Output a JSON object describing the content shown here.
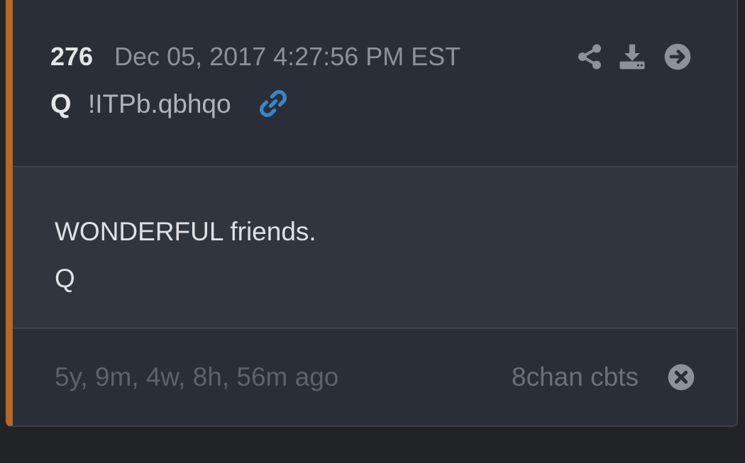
{
  "post": {
    "number": "276",
    "date": "Dec 05, 2017 4:27:56 PM EST",
    "author": "Q",
    "tripcode": "!ITPb.qbhqo",
    "body_lines": [
      "WONDERFUL friends.",
      "Q"
    ],
    "time_ago": "5y, 9m, 4w, 8h, 56m ago",
    "source": "8chan cbts"
  },
  "icons": {
    "link": "link-icon",
    "share": "share-icon",
    "download": "download-icon",
    "goto": "arrow-right-circle-icon",
    "close": "close-circle-icon"
  },
  "colors": {
    "accent_bar": "#b06a2a",
    "link_icon": "#3a86c8",
    "background": "#212327",
    "card": "#2a2e36",
    "card_body": "#31353d"
  }
}
